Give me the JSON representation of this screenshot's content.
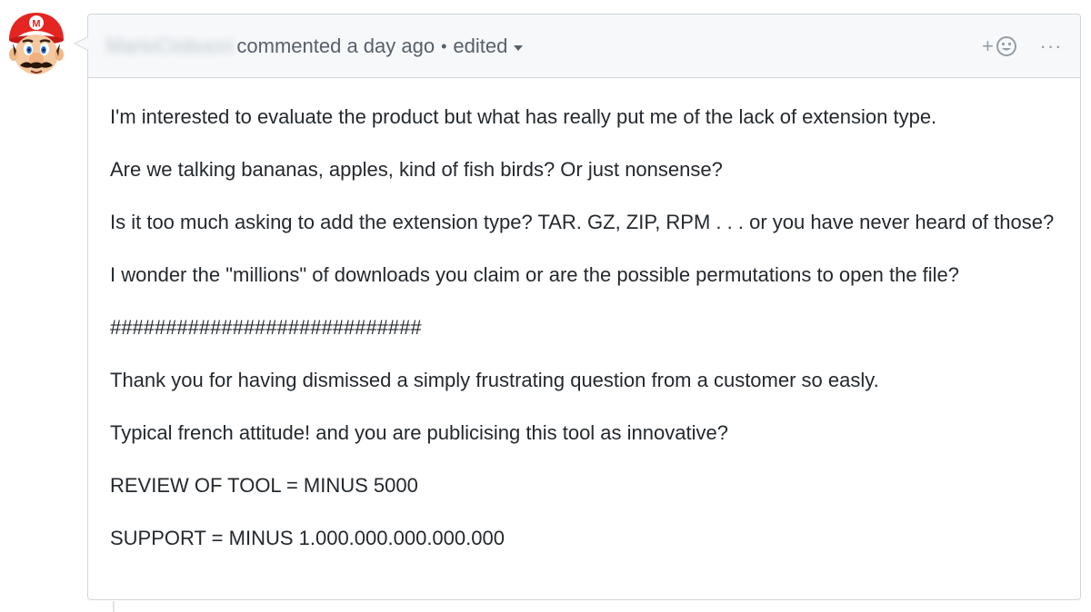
{
  "comment": {
    "author": "MarioCiobucci",
    "action": "commented a day ago",
    "separator": "•",
    "edited_label": "edited",
    "reaction_plus": "+",
    "more_label": "···",
    "paragraphs": [
      "I'm interested to evaluate the product but what has really put me of the lack of extension type.",
      "Are we talking bananas, apples, kind of fish birds? Or just nonsense?",
      "Is it too much asking to add the extension type? TAR. GZ, ZIP, RPM . . . or you have never heard of those?",
      "I wonder the \"millions\" of downloads you claim or are the possible permutations to open the file?",
      "############################",
      "Thank you for having dismissed a simply frustrating question from a customer so easly.",
      "Typical french attitude! and you are publicising this tool as innovative?",
      "REVIEW OF TOOL = MINUS 5000",
      "SUPPORT = MINUS 1.000.000.000.000.000"
    ]
  },
  "icons": {
    "avatar": "mario-avatar-icon",
    "reaction": "smiley-icon",
    "dropdown": "caret-down-icon"
  },
  "colors": {
    "header_bg": "#f6f8fa",
    "border": "#d1d5da",
    "muted_text": "#586069",
    "body_text": "#24292e",
    "mario_red": "#e52521"
  }
}
